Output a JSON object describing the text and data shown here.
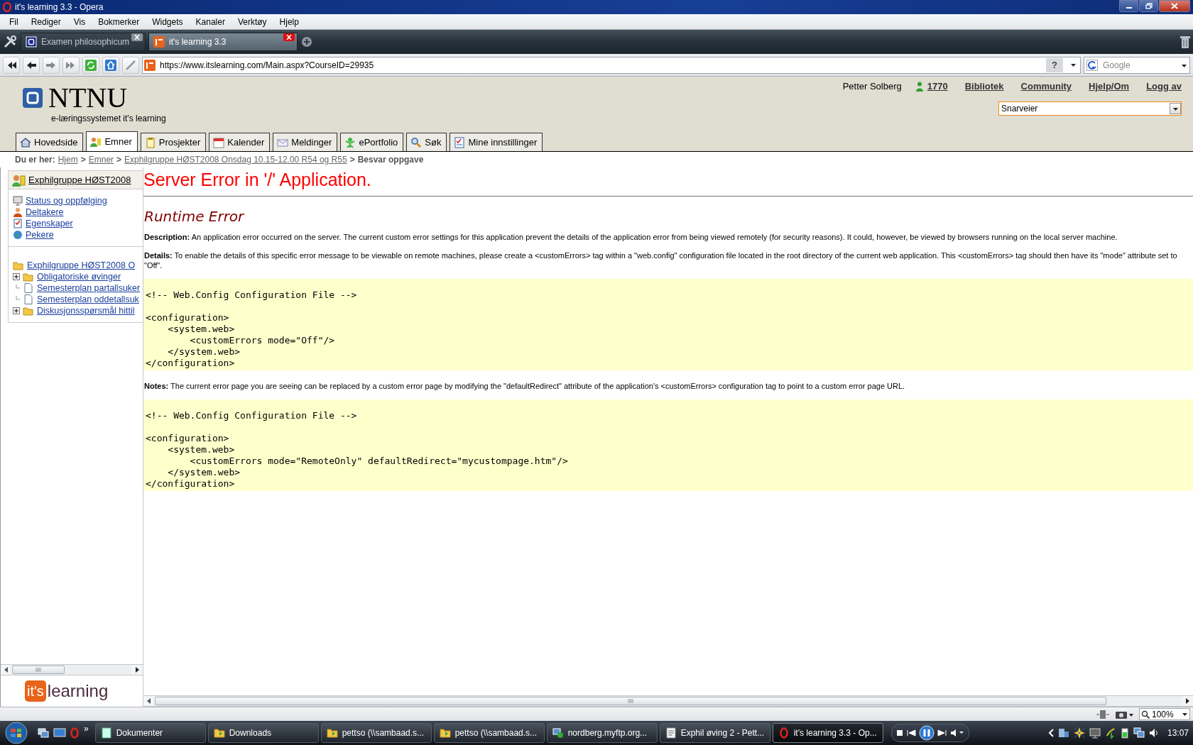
{
  "window": {
    "title": "it's learning 3.3 - Opera"
  },
  "menu_bar": [
    "Fil",
    "Rediger",
    "Vis",
    "Bokmerker",
    "Widgets",
    "Kanaler",
    "Verktøy",
    "Hjelp"
  ],
  "browser_tabs": [
    {
      "label": "Examen philosophicum",
      "selected": false
    },
    {
      "label": "it's learning 3.3",
      "selected": true
    }
  ],
  "address_bar": {
    "url": "https://www.itslearning.com/Main.aspx?CourseID=29935",
    "site_info": "?",
    "search": {
      "placeholder": "Google"
    }
  },
  "site_header": {
    "logo_text": "NTNU",
    "subtitle": "e-læringssystemet it's learning",
    "user": "Petter Solberg",
    "points": "1770",
    "links": [
      "Bibliotek",
      "Community",
      "Hjelp/Om",
      "Logg av"
    ],
    "shortcuts": {
      "value": "Snarveier"
    }
  },
  "nav_tabs": [
    {
      "label": "Hovedside",
      "selected": false
    },
    {
      "label": "Emner",
      "selected": true
    },
    {
      "label": "Prosjekter",
      "selected": false
    },
    {
      "label": "Kalender",
      "selected": false
    },
    {
      "label": "Meldinger",
      "selected": false
    },
    {
      "label": "ePortfolio",
      "selected": false
    },
    {
      "label": "Søk",
      "selected": false
    },
    {
      "label": "Mine innstillinger",
      "selected": false
    }
  ],
  "breadcrumb": {
    "label": "Du er her:",
    "items": [
      {
        "text": "Hjem",
        "kind": "link"
      },
      {
        "text": ">",
        "kind": "separator"
      },
      {
        "text": "Emner",
        "kind": "link"
      },
      {
        "text": ">",
        "kind": "separator"
      },
      {
        "text": "Exphilgruppe HØST2008 Onsdag 10.15-12.00 R54 og R55",
        "kind": "link"
      },
      {
        "text": ">",
        "kind": "separator"
      },
      {
        "text": "Besvar oppgave",
        "kind": "current"
      }
    ]
  },
  "sidebar": {
    "course": "Exphilgruppe HØST2008",
    "links": [
      "Status og oppfølging",
      "Deltakere",
      "Egenskaper",
      "Pekere"
    ],
    "tree": {
      "label": "Exphilgruppe HØST2008 O",
      "children": [
        {
          "label": "Obligatoriske øvinger",
          "kind": "folder",
          "expanded": false
        },
        {
          "label": "Semesterplan partallsuker",
          "kind": "document"
        },
        {
          "label": "Semesterplan oddetallsuk",
          "kind": "document"
        },
        {
          "label": "Diskusjonsspørsmål hittil",
          "kind": "folder",
          "expanded": false
        }
      ]
    },
    "brand_logo": {
      "badge": "it's",
      "text": "learning"
    }
  },
  "error_page": {
    "title": "Server Error in '/' Application.",
    "heading": "Runtime Error",
    "description": "**Description:** An application error occurred on the server. The current custom error settings for this application prevent the details of the application error from being viewed remotely (for security reasons). It could, however, be viewed by browsers running on the local server machine.",
    "details": "**Details:** To enable the details of this specific error message to be viewable on remote machines, please create a <customErrors> tag within a \"web.config\" configuration file located in the root directory of the current web application. This <customErrors> tag should then have its \"mode\" attribute set to \"Off\".",
    "code_1": "<!-- Web.Config Configuration File -->\n\n<configuration>\n    <system.web>\n        <customErrors mode=\"Off\"/>\n    </system.web>\n</configuration>",
    "notes": "**Notes:** The current error page you are seeing can be replaced by a custom error page by modifying the \"defaultRedirect\" attribute of the application's <customErrors> configuration tag to point to a custom error page URL.",
    "code_2": "<!-- Web.Config Configuration File -->\n\n<configuration>\n    <system.web>\n        <customErrors mode=\"RemoteOnly\" defaultRedirect=\"mycustompage.htm\"/>\n    </system.web>\n</configuration>"
  },
  "status_bar": {
    "zoom": "100%"
  },
  "taskbar": {
    "more": "»",
    "items": [
      {
        "label": "Dokumenter",
        "selected": false
      },
      {
        "label": "Downloads",
        "selected": false
      },
      {
        "label": "pettso (\\\\sambaad.s...",
        "selected": false
      },
      {
        "label": "pettso (\\\\sambaad.s...",
        "selected": false
      },
      {
        "label": "nordberg.myftp.org...",
        "selected": false
      },
      {
        "label": "Exphil øving 2 - Pett...",
        "selected": false
      },
      {
        "label": "it's learning 3.3 - Op...",
        "selected": true
      }
    ],
    "clock": "13:07"
  }
}
